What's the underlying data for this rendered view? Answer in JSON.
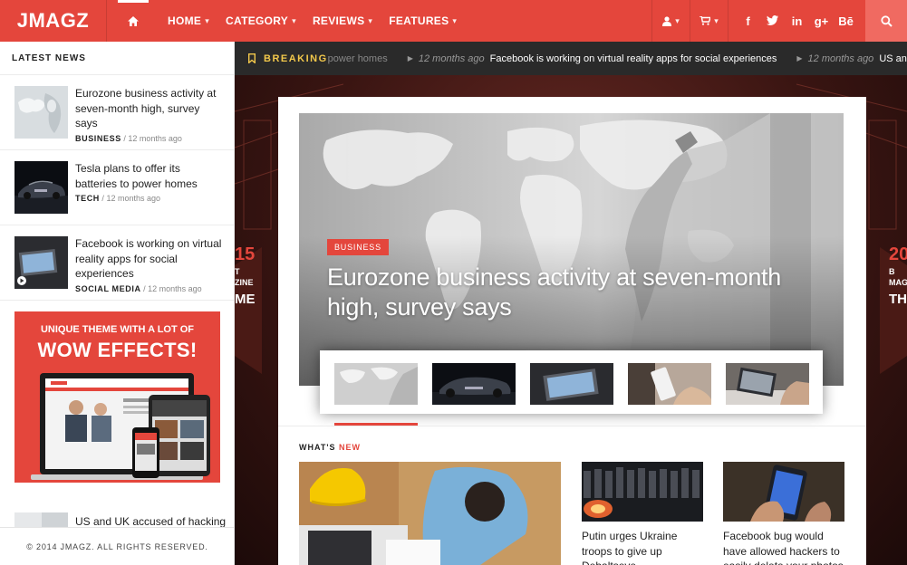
{
  "brand": {
    "name": "JMAGZ",
    "accent": "#e4463c",
    "breaking_color": "#f2c84b"
  },
  "nav": {
    "home_icon": "home-icon",
    "items": [
      {
        "label": "HOME"
      },
      {
        "label": "CATEGORY"
      },
      {
        "label": "REVIEWS"
      },
      {
        "label": "FEATURES"
      }
    ],
    "utility_icons": [
      "user-icon",
      "cart-icon"
    ],
    "social": [
      "f",
      "t",
      "in",
      "g+",
      "Bē"
    ],
    "search_icon": "search-icon"
  },
  "sidebar": {
    "heading": "LATEST NEWS",
    "items": [
      {
        "title": "Eurozone business activity at seven-month high, survey says",
        "category": "BUSINESS",
        "sep": "/",
        "time": "12 months ago"
      },
      {
        "title": "Tesla plans to offer its batteries to power homes",
        "category": "TECH",
        "sep": "/",
        "time": "12 months ago"
      },
      {
        "title": "Facebook is working on virtual reality apps for social experiences",
        "category": "SOCIAL MEDIA",
        "sep": "/",
        "time": "12 months ago"
      }
    ],
    "ad": {
      "line1": "UNIQUE THEME WITH A LOT OF",
      "line2": "WOW EFFECTS!"
    },
    "partial_item": "US and UK accused of hacking",
    "footer": "© 2014 JMAGZ. ALL RIGHTS RESERVED."
  },
  "breaking": {
    "label": "BREAKING",
    "ticker": [
      {
        "text": "power homes"
      },
      {
        "time": "12 months ago",
        "text": "Facebook is working on virtual reality apps for social experiences"
      },
      {
        "time": "12 months ago",
        "text": "US and UK"
      }
    ]
  },
  "background": {
    "left_text": [
      "15",
      "T",
      "ZINE",
      "ME"
    ],
    "right_text": [
      "20",
      "B",
      "MAG",
      "TH"
    ]
  },
  "hero": {
    "badge": "BUSINESS",
    "title": "Eurozone business activity at seven-month high, survey says"
  },
  "whats_new": {
    "heading_prefix": "WHAT'S",
    "heading_accent": "NEW",
    "items": [
      {
        "title": "Putin urges Ukraine troops to give up Debaltseve"
      },
      {
        "title": "Facebook bug would have allowed hackers to easily delete your photos"
      }
    ]
  }
}
